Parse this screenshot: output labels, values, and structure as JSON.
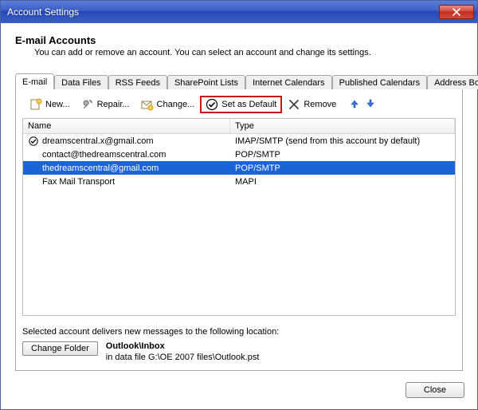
{
  "window": {
    "title": "Account Settings",
    "close_icon": "close"
  },
  "header": {
    "title": "E-mail Accounts",
    "subtitle": "You can add or remove an account. You can select an account and change its settings."
  },
  "tabs": [
    {
      "label": "E-mail",
      "active": true
    },
    {
      "label": "Data Files",
      "active": false
    },
    {
      "label": "RSS Feeds",
      "active": false
    },
    {
      "label": "SharePoint Lists",
      "active": false
    },
    {
      "label": "Internet Calendars",
      "active": false
    },
    {
      "label": "Published Calendars",
      "active": false
    },
    {
      "label": "Address Books",
      "active": false
    }
  ],
  "toolbar": {
    "new": "New...",
    "repair": "Repair...",
    "change": "Change...",
    "set_default": "Set as Default",
    "remove": "Remove"
  },
  "columns": {
    "name": "Name",
    "type": "Type"
  },
  "accounts": [
    {
      "name": "dreamscentral.x@gmail.com",
      "type": "IMAP/SMTP (send from this account by default)",
      "is_default": true,
      "selected": false
    },
    {
      "name": "contact@thedreamscentral.com",
      "type": "POP/SMTP",
      "is_default": false,
      "selected": false
    },
    {
      "name": "thedreamscentral@gmail.com",
      "type": "POP/SMTP",
      "is_default": false,
      "selected": true
    },
    {
      "name": "Fax Mail Transport",
      "type": "MAPI",
      "is_default": false,
      "selected": false
    }
  ],
  "delivery": {
    "label": "Selected account delivers new messages to the following location:",
    "change_folder": "Change Folder",
    "location_main": "Outlook\\Inbox",
    "location_detail": "in data file G:\\OE 2007 files\\Outlook.pst"
  },
  "buttons": {
    "close": "Close"
  }
}
